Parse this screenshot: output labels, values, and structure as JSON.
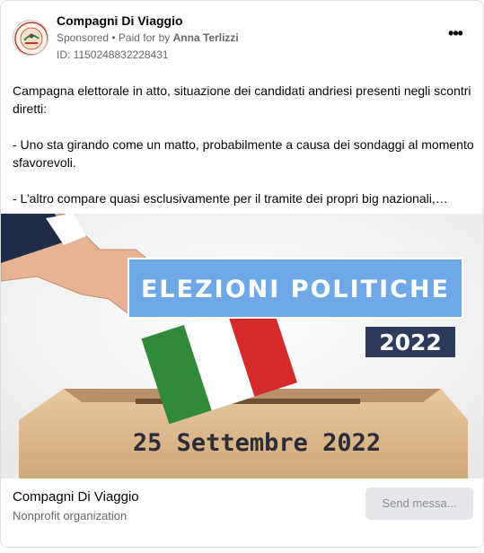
{
  "post": {
    "page_name": "Compagni Di Viaggio",
    "sponsored": "Sponsored",
    "separator": " • ",
    "paid_for_prefix": "Paid for by ",
    "paid_for_name": "Anna Terlizzi",
    "ad_id": "ID: 1150248832228431",
    "more_icon": "•••",
    "avatar_text": "COMPAGNI DI VIAGGIO"
  },
  "body": {
    "paragraphs": [
      "Campagna elettorale in atto, situazione dei candidati andriesi presenti negli scontri diretti:",
      "- Uno sta girando come un matto, probabilmente a causa dei sondaggi al momento sfavorevoli.",
      "- L’altro compare quasi esclusivamente per il tramite dei propri big nazionali,…"
    ]
  },
  "media": {
    "banner_title": "ELEZIONI POLITICHE",
    "year": "2022",
    "date_text": "25 Settembre 2022",
    "colors": {
      "banner": "#6fa8e6",
      "year_box": "#2e3a5c",
      "flag_green": "#2f8b3a",
      "flag_red": "#d42a2a",
      "box": "#d9b68a"
    }
  },
  "footer": {
    "name": "Compagni Di Viaggio",
    "category": "Nonprofit organization",
    "send_button": "Send messa..."
  }
}
